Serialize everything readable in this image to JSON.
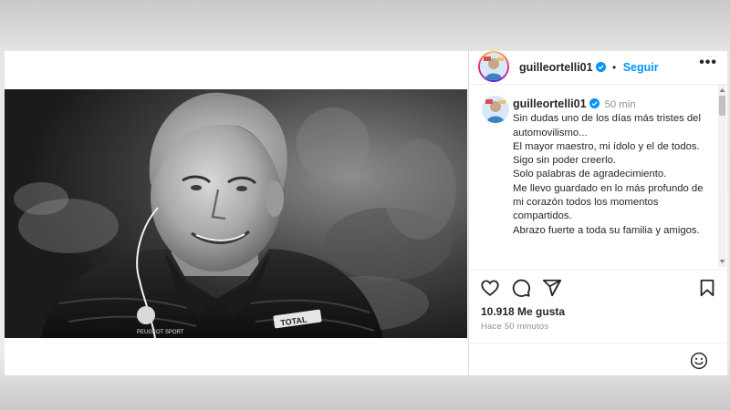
{
  "post": {
    "username": "guilleortelli01",
    "follow_label": "Seguir",
    "more_label": "•••",
    "caption_time": "50 min",
    "caption_lines": [
      "Sin dudas uno de los días más tristes del automovilismo...",
      "El mayor maestro, mi ídolo y el de todos.",
      "Sigo sin poder creerlo.",
      "Solo palabras de agradecimiento.",
      "Me llevo guardado en lo más profundo de mi corazón todos los momentos compartidos.",
      "Abrazo fuerte a toda su familia y amigos."
    ],
    "likes": "10.918 Me gusta",
    "posted_ago": "Hace 50 minutos",
    "photo_text": {
      "jacket_logo": "TOTAL",
      "badge": "PEUGEOT SPORT"
    }
  },
  "icons": {
    "like": "heart-icon",
    "comment": "comment-icon",
    "share": "share-icon",
    "save": "bookmark-icon",
    "emoji": "emoji-icon",
    "verified": "verified-badge-icon"
  },
  "colors": {
    "link_blue": "#0095f6",
    "text": "#262626",
    "muted": "#8e8e8e"
  }
}
